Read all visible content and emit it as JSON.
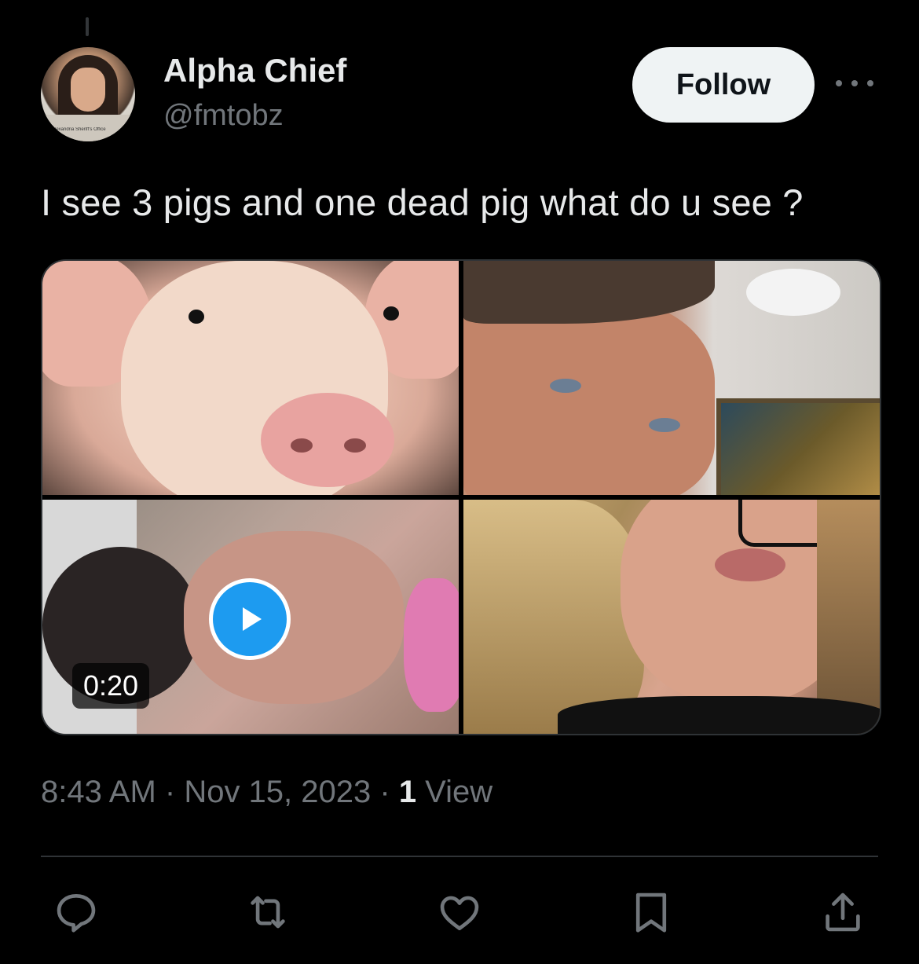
{
  "tweet": {
    "author": {
      "name": "Alpha Chief",
      "handle": "@fmtobz",
      "avatar_caption": "Alexandria Sheriff's Office"
    },
    "follow_label": "Follow",
    "text": "I see 3 pigs and one dead pig what do u see ?",
    "media": {
      "video_duration": "0:20"
    },
    "meta": {
      "time": "8:43 AM",
      "separator": " · ",
      "date": "Nov 15, 2023",
      "views_count": "1",
      "views_label": " View"
    },
    "actions": [
      {
        "name": "reply",
        "icon": "reply-icon"
      },
      {
        "name": "retweet",
        "icon": "retweet-icon"
      },
      {
        "name": "like",
        "icon": "heart-icon"
      },
      {
        "name": "bookmark",
        "icon": "bookmark-icon"
      },
      {
        "name": "share",
        "icon": "share-icon"
      }
    ]
  },
  "colors": {
    "background": "#000000",
    "text_primary": "#e7e9ea",
    "text_secondary": "#71767b",
    "follow_bg": "#eff3f4",
    "accent": "#1d9bf0"
  }
}
